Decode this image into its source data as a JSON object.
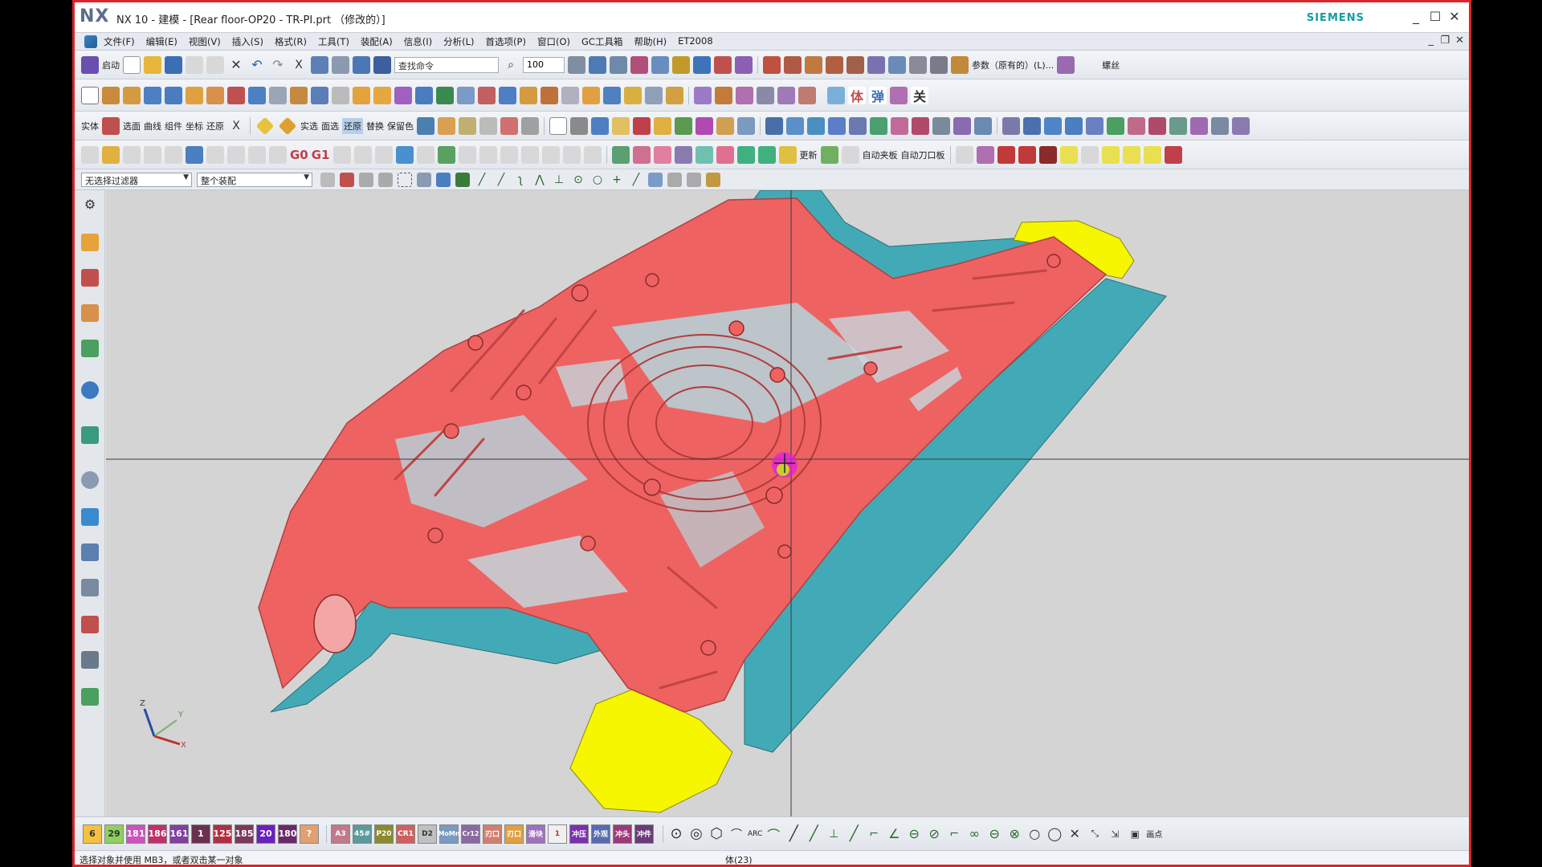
{
  "window": {
    "logo": "NX",
    "title": "NX 10 - 建模 - [Rear floor-OP20 - TR-PI.prt （修改的）]",
    "brand": "SIEMENS",
    "minimize": "_",
    "maximize": "☐",
    "close": "✕"
  },
  "menubar": {
    "items": [
      "文件(F)",
      "编辑(E)",
      "视图(V)",
      "插入(S)",
      "格式(R)",
      "工具(T)",
      "装配(A)",
      "信息(I)",
      "分析(L)",
      "首选项(P)",
      "窗口(O)",
      "GC工具箱",
      "帮助(H)",
      "ET2008"
    ],
    "doc_min": "_",
    "doc_restore": "❐",
    "doc_close": "✕"
  },
  "toolbar1": {
    "start_label": "启动",
    "search_placeholder": "查找命令",
    "zoom_value": "100",
    "param_label": "参数（原有的）(L)...",
    "thread_label": "螺丝"
  },
  "toolbar3": {
    "labels": [
      "实体",
      "选面",
      "曲线",
      "组件",
      "坐标",
      "还原"
    ],
    "right_labels": [
      "实选",
      "面选",
      "还原",
      "替换",
      "保留色"
    ]
  },
  "toolbar4": {
    "labels": [
      "G0",
      "G1"
    ],
    "right_labels": [
      "更新",
      "自动夹板",
      "自动刀口板"
    ]
  },
  "selection_bar": {
    "filter": "无选择过滤器",
    "scope": "整个装配"
  },
  "layers": {
    "items": [
      "6",
      "29",
      "181",
      "186",
      "161",
      "1",
      "125",
      "185",
      "20",
      "180",
      "?",
      "A3",
      "45#",
      "P20",
      "CR1",
      "D2",
      "MoMn",
      "Cr12",
      "刃口",
      "刃口",
      "滑块",
      "1",
      "冲压",
      "外观",
      "冲头",
      "冲件"
    ]
  },
  "snap_toolbar": {
    "arc_label": "ARC",
    "points_label": "画点"
  },
  "status": {
    "prompt": "选择对象并使用 MB3，或者双击某一对象",
    "selection": "体(23)"
  },
  "colors": {
    "part_red": "#ef6262",
    "wall_teal": "#41aab6",
    "addendum_yellow": "#f6f600",
    "viewport_bg": "#d4d4d4",
    "frame_border": "#d9252a"
  },
  "triad": {
    "x": "X",
    "y": "Y",
    "z": "Z"
  }
}
